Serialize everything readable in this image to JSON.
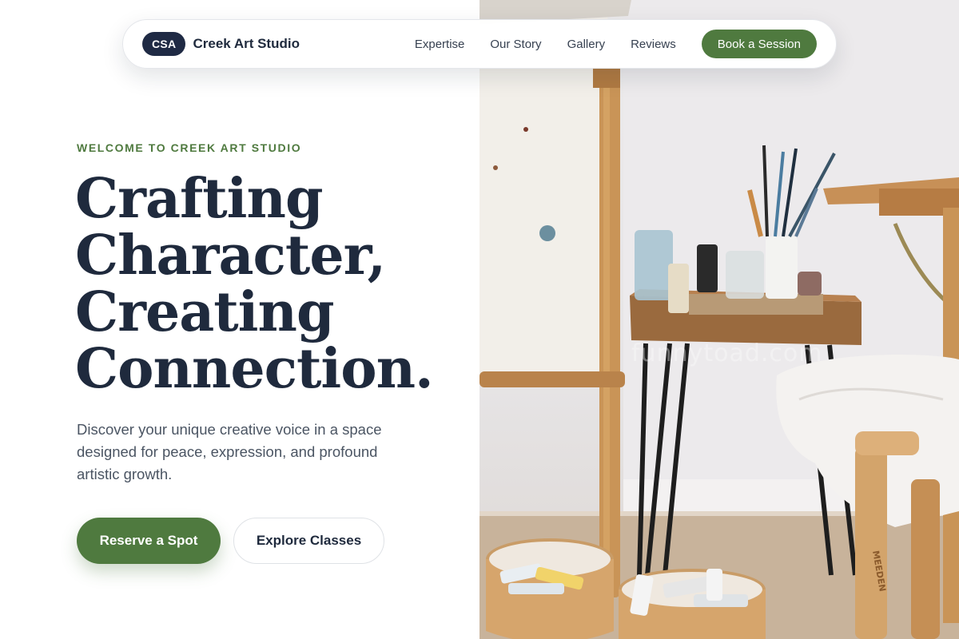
{
  "nav": {
    "brand_badge": "CSA",
    "brand_name": "Creek Art Studio",
    "links": [
      "Expertise",
      "Our Story",
      "Gallery",
      "Reviews"
    ],
    "cta": "Book a Session"
  },
  "hero": {
    "eyebrow": "WELCOME TO CREEK ART STUDIO",
    "headline_lines": [
      "Crafting",
      "Character,",
      "Creating",
      "Connection."
    ],
    "lead": "Discover your unique creative voice in a space designed for peace, expression, and profound artistic growth.",
    "primary_button": "Reserve a Spot",
    "secondary_button": "Explore Classes"
  },
  "photo": {
    "watermark": "funnytoad.com",
    "easel_text": "MEEDEN"
  },
  "colors": {
    "accent_green": "#4f7a3f",
    "navy": "#1f2a3d",
    "body_gray": "#4b5563"
  }
}
